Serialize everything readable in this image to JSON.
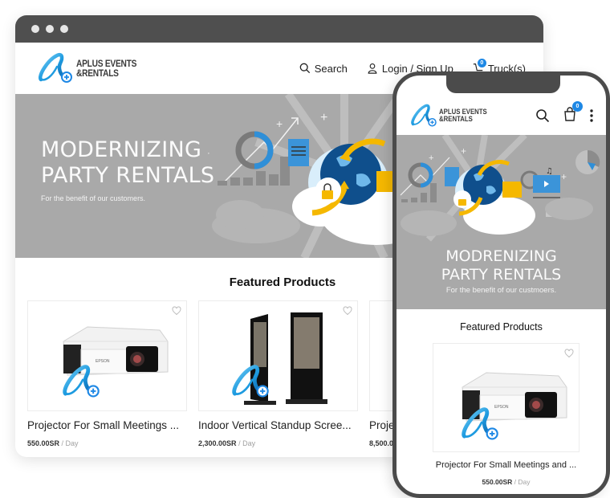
{
  "browser": {
    "window_controls": [
      "close",
      "minimize",
      "maximize"
    ]
  },
  "header": {
    "logo_line1": "APLUS EVENTS",
    "logo_line2": "&RENTALS",
    "nav": {
      "search_label": "Search",
      "login_label": "Login / Sign Up",
      "cart_label": "Truck(s)",
      "cart_count": "0"
    }
  },
  "hero": {
    "title_line1": "MODERNIZING",
    "title_line2": "PARTY RENTALS",
    "subtitle": "For the benefit of our customers."
  },
  "featured": {
    "title": "Featured Products",
    "products": [
      {
        "name": "Projector For Small Meetings ...",
        "price": "550.00SR",
        "unit": "/ Day",
        "image": "projector"
      },
      {
        "name": "Indoor Vertical Standup Scree...",
        "price": "2,300.00SR",
        "unit": "/ Day",
        "image": "standup-screen"
      },
      {
        "name": "Proje",
        "price": "8,500.0",
        "unit": "",
        "image": "none"
      }
    ]
  },
  "mobile": {
    "logo_line1": "APLUS EVENTS",
    "logo_line2": "&RENTALS",
    "cart_count": "0",
    "hero": {
      "title_line1": "MODRENIZING",
      "title_line2": "PARTY RENTALS",
      "subtitle": "For the benefit of our custmoers."
    },
    "featured_title": "Featured Products",
    "product": {
      "name": "Projector For Small Meetings and ...",
      "price": "550.00SR",
      "unit": "/ Day"
    }
  },
  "colors": {
    "accent_blue": "#1e88e5",
    "frame_dark": "#4b4b4b",
    "hero_gray": "#a9a9a9",
    "yellow": "#f5b800"
  }
}
